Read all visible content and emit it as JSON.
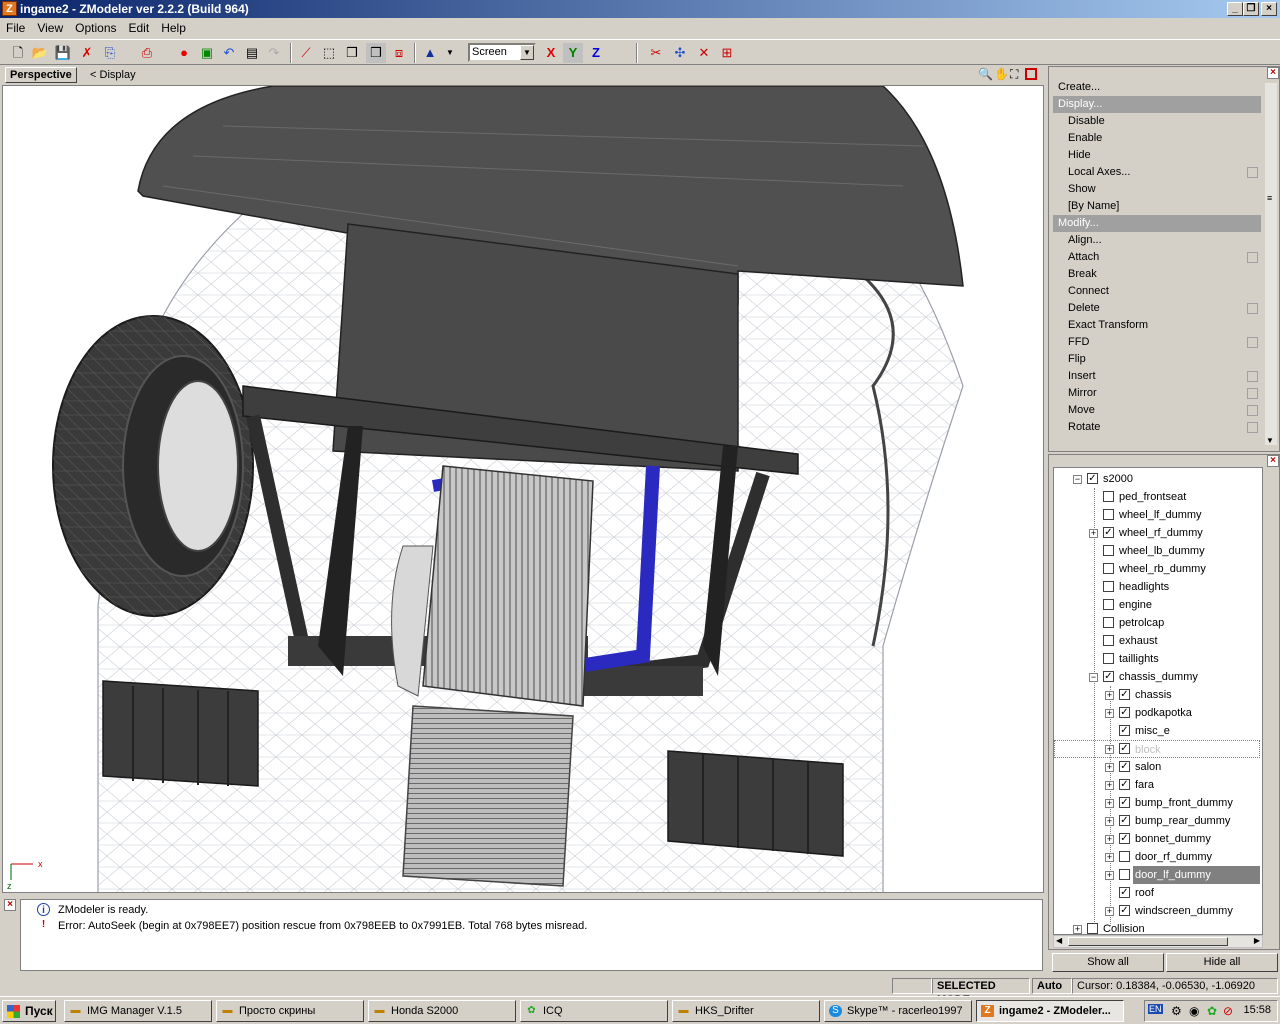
{
  "window": {
    "title": "ingame2 - ZModeler ver 2.2.2 (Build 964)",
    "icon_letter": "Z"
  },
  "menu": [
    "File",
    "View",
    "Options",
    "Edit",
    "Help"
  ],
  "toolbar": {
    "coord_mode": "Screen",
    "axis_x": "X",
    "axis_y": "Y",
    "axis_z": "Z",
    "colors": {
      "x": "#e00000",
      "y": "#008000",
      "z": "#0000e0"
    }
  },
  "viewport": {
    "tab_label": "Perspective",
    "nav_arrow": "<",
    "display_label": "Display",
    "axis_x": "x",
    "axis_z": "z"
  },
  "command_panel": {
    "create": "Create...",
    "display_header": "Display...",
    "display_items": [
      "Disable",
      "Enable",
      "Hide",
      "Local Axes...",
      "Show",
      "[By Name]"
    ],
    "modify_header": "Modify...",
    "modify_items": [
      "Align...",
      "Attach",
      "Break",
      "Connect",
      "Delete",
      "Exact Transform",
      "FFD",
      "Flip",
      "Insert",
      "Mirror",
      "Move",
      "Rotate"
    ]
  },
  "tree": {
    "root": "s2000",
    "items": [
      "ped_frontseat",
      "wheel_lf_dummy",
      "wheel_rf_dummy",
      "wheel_lb_dummy",
      "wheel_rb_dummy",
      "headlights",
      "engine",
      "petrolcap",
      "exhaust",
      "taillights",
      "chassis_dummy",
      "chassis",
      "podkapotka",
      "misc_e",
      "block",
      "salon",
      "fara",
      "bump_front_dummy",
      "bump_rear_dummy",
      "bonnet_dummy",
      "door_rf_dummy",
      "door_lf_dummy",
      "roof",
      "windscreen_dummy",
      "Collision"
    ],
    "show_all": "Show all",
    "hide_all": "Hide all"
  },
  "log": {
    "lines": [
      "ZModeler is ready.",
      "Error: AutoSeek (begin at 0x798EE7) position rescue  from 0x798EEB to 0x7991EB. Total 768 bytes misread."
    ]
  },
  "status": {
    "mode": "SELECTED MODE",
    "auto": "Auto",
    "cursor": "Cursor: 0.18384, -0.06530, -1.06920"
  },
  "taskbar": {
    "start": "Пуск",
    "tasks": [
      "IMG Manager V.1.5",
      "Просто скрины",
      "Honda S2000",
      "ICQ",
      "HKS_Drifter",
      "Skype™ - racerleo1997",
      "ingame2 - ZModeler..."
    ],
    "lang": "EN",
    "clock": "15:58"
  }
}
